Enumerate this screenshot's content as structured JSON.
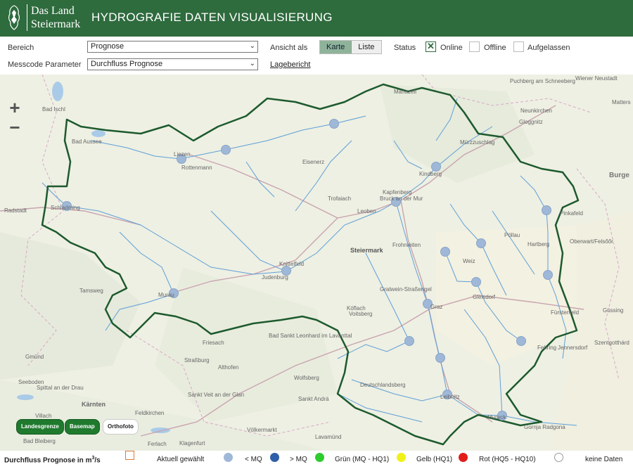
{
  "header": {
    "logo_line1": "Das Land",
    "logo_line2": "Steiermark",
    "title": "HYDROGRAFIE DATEN VISUALISIERUNG"
  },
  "controls": {
    "bereich_label": "Bereich",
    "bereich_value": "Prognose",
    "messcode_label": "Messcode Parameter",
    "messcode_value": "Durchfluss Prognose",
    "ansicht_label": "Ansicht als",
    "view_karte": "Karte",
    "view_liste": "Liste",
    "status_label": "Status",
    "status_online": "Online",
    "status_offline": "Offline",
    "status_aufgelassen": "Aufgelassen",
    "lagebericht": "Lagebericht",
    "online_checked": true
  },
  "map": {
    "zoom_in": "+",
    "zoom_out": "−",
    "places": {
      "bad_ischl": "Bad Ischl",
      "bad_aussee": "Bad Aussee",
      "liezen": "Liezen",
      "rottenmann": "Rottenmann",
      "radstadt": "Radstadt",
      "schladming": "Schladming",
      "tamsweg": "Tamsweg",
      "murau": "Murau",
      "mariazell": "Mariazell",
      "eisenerz": "Eisenerz",
      "trofaiach": "Trofaiach",
      "leoben": "Leoben",
      "kapfenberg": "Kapfenberg",
      "bruck": "Bruck an der Mur",
      "muerzzuschlag": "Mürzzuschlag",
      "kindberg": "Kindberg",
      "puchberg": "Puchberg am Schneeberg",
      "wiener_neustadt": "Wiener Neustadt",
      "neunkirchen": "Neunkirchen",
      "gloggnitz": "Gloggnitz",
      "mattersburg": "Matters",
      "burgenland": "Burge",
      "pinkafeld": "Pinkafeld",
      "pollau": "Pöllau",
      "hartberg": "Hartberg",
      "oberwart": "Oberwart/Felsőőr",
      "guessing": "Güssing",
      "fuerstenfeld": "Fürstenfeld",
      "szentgotthard": "Szentgotthárd",
      "fehring": "Fehring",
      "jennersdorf": "Jennersdorf",
      "steiermark": "Steiermark",
      "frohnleiten": "Frohnleiten",
      "weiz": "Weiz",
      "gleisdorf": "Gleisdorf",
      "knittelfeld": "Knittelfeld",
      "judenburg": "Judenburg",
      "graz": "Graz",
      "gratwein": "Gratwein-Straßengel",
      "koeflach": "Köflach",
      "voitsberg": "Voitsberg",
      "friesach": "Friesach",
      "bad_st_leonhard": "Bad Sankt Leonhard im Lavanttal",
      "strassburg": "Straßburg",
      "althofen": "Althofen",
      "wolfsberg": "Wolfsberg",
      "deutschlandsberg": "Deutschlandsberg",
      "leibnitz": "Leibnitz",
      "gmuend": "Gmünd",
      "seeboden": "Seeboden",
      "spittal": "Spittal an der Drau",
      "sankt_veit": "Sankt Veit an der Glan",
      "kaernten": "Kärnten",
      "feldkirchen": "Feldkirchen",
      "sankt_andrae": "Sankt Andrä",
      "villach": "Villach",
      "bad_bleiberg": "Bad Bleiberg",
      "voelkermarkt": "Völkermarkt",
      "klagenfurt": "Klagenfurt",
      "lavamuend": "Lavamünd",
      "mureck": "Mureck",
      "gornja": "Gornja Radgona",
      "ferlach": "Ferlach"
    },
    "buttons": {
      "landesgrenze": "Landesgrenze",
      "basemap": "Basemap",
      "orthofoto": "Orthofoto"
    }
  },
  "legend": {
    "title_main": "Durchfluss Prognose in m",
    "title_sup": "3",
    "title_tail": "/s",
    "aktuell": "Aktuell gewählt",
    "lt_mq": "< MQ",
    "gt_mq": "> MQ",
    "gruen": "Grün (MQ - HQ1)",
    "gelb": "Gelb (HQ1)",
    "rot": "Rot (HQ5 - HQ10)",
    "keine": "keine Daten",
    "colors": {
      "lt_mq": "#9fb8d8",
      "gt_mq": "#2f5fa8",
      "gruen": "#2ecc2e",
      "gelb": "#f1f11a",
      "rot": "#e21b1b",
      "keine": "#ffffff",
      "aktuell": "#e07a3a",
      "header": "#2e6b3d"
    }
  }
}
